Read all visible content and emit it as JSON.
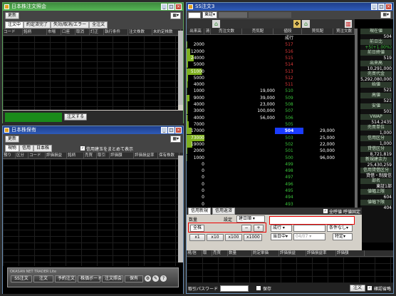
{
  "orders_window": {
    "title": "日本株注文照会",
    "update_button": "更新",
    "tabs": [
      "注文中",
      "約定済完了",
      "失効/取消/エラー",
      "全注文"
    ],
    "columns": [
      "コード",
      "銘柄",
      "市場",
      "口座",
      "取消",
      "訂正",
      "執行条件",
      "注文株数",
      "未約定株数"
    ],
    "order_button": "注文する"
  },
  "holdings_window": {
    "title": "日本株保有",
    "update_button": "更新",
    "tabs": [
      "現物",
      "信用",
      "日本株"
    ],
    "checkbox_label": "信用建玉をまとめて表示",
    "columns": [
      "預り",
      "区分",
      "コード",
      "評価損益",
      "銘柄",
      "売買",
      "取引",
      "評価額",
      "評価損益率",
      "保有株数"
    ]
  },
  "launcher": {
    "brand": "OKASAN NET TRADER Lite",
    "buttons": [
      "SS注文",
      "注文",
      "予約注文",
      "株価ボード",
      "注文照会",
      "保有"
    ]
  },
  "ss_window": {
    "title": "SS注文3",
    "market": "東証",
    "board_columns": [
      "出来高",
      "清",
      "売注文数",
      "売気配",
      "値段",
      "買気配",
      "買注文数"
    ],
    "board_rows": [
      {
        "vol": "",
        "sell": "",
        "price": "成行",
        "buy": ""
      },
      {
        "vol": "2000",
        "sell": "",
        "price": "517",
        "buy": ""
      },
      {
        "vol": "12000",
        "sell": "",
        "price": "516",
        "buy": ""
      },
      {
        "vol": "24000",
        "sell": "",
        "price": "515",
        "buy": ""
      },
      {
        "vol": "5000",
        "sell": "",
        "price": "514",
        "buy": ""
      },
      {
        "vol": "51000",
        "sell": "",
        "price": "513",
        "buy": ""
      },
      {
        "vol": "5000",
        "sell": "",
        "price": "512",
        "buy": ""
      },
      {
        "vol": "4000",
        "sell": "",
        "price": "511",
        "buy": ""
      },
      {
        "vol": "1000",
        "sell": "19,000",
        "price": "510",
        "buy": ""
      },
      {
        "vol": "9000",
        "sell": "39,000",
        "price": "509",
        "buy": ""
      },
      {
        "vol": "4000",
        "sell": "23,000",
        "price": "508",
        "buy": ""
      },
      {
        "vol": "3000",
        "sell": "100,000",
        "price": "507",
        "buy": ""
      },
      {
        "vol": "4000",
        "sell": "56,000",
        "price": "506",
        "buy": ""
      },
      {
        "vol": "7000",
        "sell": "",
        "price": "505",
        "buy": ""
      },
      {
        "vol": "17000",
        "sell": "",
        "price": "504",
        "buy": "29,000"
      },
      {
        "vol": "73000",
        "sell": "",
        "price": "503",
        "buy": "25,000"
      },
      {
        "vol": "19000",
        "sell": "",
        "price": "502",
        "buy": "22,000"
      },
      {
        "vol": "2000",
        "sell": "",
        "price": "501",
        "buy": "50,000"
      },
      {
        "vol": "1000",
        "sell": "",
        "price": "500",
        "buy": "96,000"
      },
      {
        "vol": "0",
        "sell": "",
        "price": "499",
        "buy": ""
      },
      {
        "vol": "0",
        "sell": "",
        "price": "498",
        "buy": ""
      },
      {
        "vol": "0",
        "sell": "",
        "price": "497",
        "buy": ""
      },
      {
        "vol": "0",
        "sell": "",
        "price": "496",
        "buy": ""
      },
      {
        "vol": "0",
        "sell": "",
        "price": "495",
        "buy": ""
      },
      {
        "vol": "0",
        "sell": "",
        "price": "494",
        "buy": ""
      },
      {
        "vol": "0",
        "sell": "",
        "price": "493",
        "buy": ""
      }
    ],
    "highlight_price": "504",
    "info_panel": [
      {
        "label": "現在値",
        "value": "504"
      },
      {
        "label": "前日比",
        "value": "+5(+1.00%)"
      },
      {
        "label": "前日終値",
        "value": "519"
      },
      {
        "label": "出来高",
        "value": "10,291,000"
      },
      {
        "label": "売買代金",
        "value": "5,292,080,000"
      },
      {
        "label": "始値",
        "value": "521"
      },
      {
        "label": "高値",
        "value": "521"
      },
      {
        "label": "安値",
        "value": "501"
      },
      {
        "label": "VWAP",
        "value": "514.2435"
      },
      {
        "label": "売買単位",
        "value": "1,000"
      },
      {
        "label": "信用区分",
        "value": "1,000"
      },
      {
        "label": "貸借区分",
        "value": "8,721,819"
      },
      {
        "label": "新規建余力",
        "value": "25,430,259"
      },
      {
        "label": "信用貸借区分",
        "value": "貸借・制度信"
      },
      {
        "label": "部名",
        "value": "東証1部"
      },
      {
        "label": "値幅上限",
        "value": "604"
      },
      {
        "label": "値幅下限",
        "value": "404"
      }
    ],
    "tabs": [
      "信用新規",
      "信用返済"
    ],
    "checkbox_all": "全呼値",
    "fixed_label": "呼値固定",
    "order_fields": {
      "qty_label": "数量",
      "setting_label": "設定",
      "period_value": "建日順",
      "price_type": "成行",
      "condition": "条件なし",
      "expiry": "当日中",
      "date": "04/07",
      "account": "特定"
    },
    "qty_buttons": [
      "x1",
      "x10",
      "x100",
      "x1000"
    ],
    "bottom_columns": [
      "現/信",
      "取",
      "売買",
      "数量",
      "約定単価",
      "評価損益",
      "評価損益率",
      "評価額"
    ],
    "password_label": "取引パスワード",
    "save_label": "保存",
    "order_button": "注文",
    "confirm_label": "確認省略"
  }
}
